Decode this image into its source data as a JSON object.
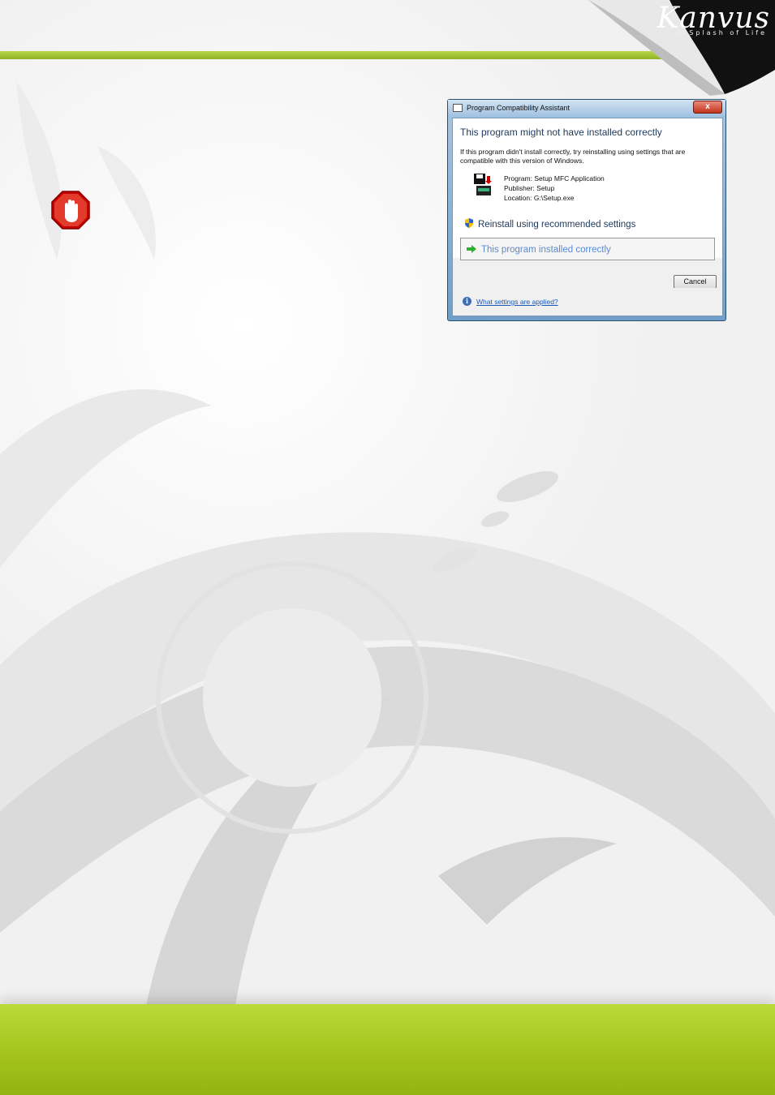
{
  "brand": {
    "name": "Kanvus",
    "tagline": "A Splash of Life"
  },
  "dialog": {
    "title": "Program Compatibility Assistant",
    "close_label": "x",
    "heading": "This program might not have installed correctly",
    "description": "If this program didn't install correctly, try reinstalling using settings that are compatible with this version of Windows.",
    "program": "Program: Setup MFC Application",
    "publisher": "Publisher: Setup",
    "location": "Location: G:\\Setup.exe",
    "option_reinstall": "Reinstall using recommended settings",
    "option_installed": "This program installed correctly",
    "cancel_label": "Cancel",
    "help_link": "What settings are applied?"
  },
  "colors": {
    "brand_green": "#a2c21a",
    "dialog_heading": "#1e395b",
    "link_blue": "#1a58b8"
  }
}
